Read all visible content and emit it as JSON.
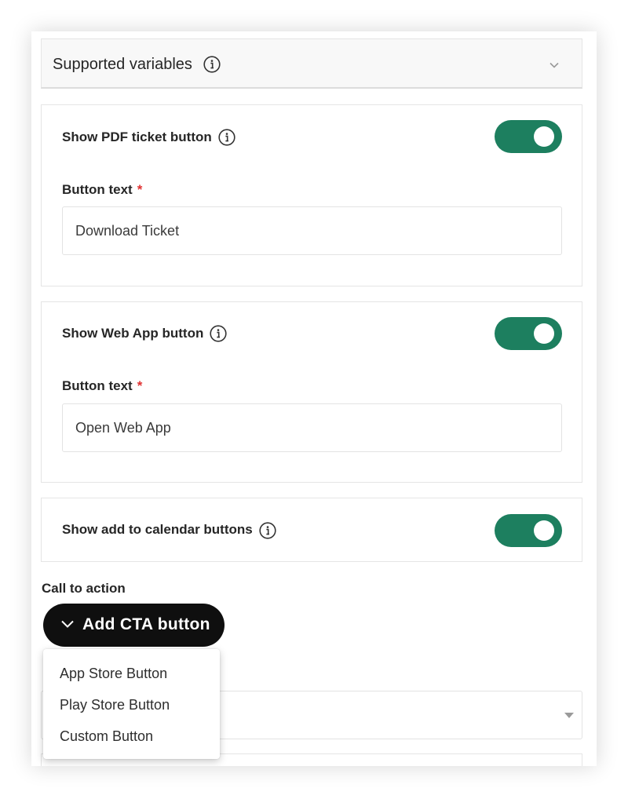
{
  "supported_variables": {
    "title": "Supported variables"
  },
  "sections": [
    {
      "toggle_label": "Show PDF ticket button",
      "toggle_on": true,
      "field_label": "Button text",
      "required_mark": "*",
      "field_value": "Download Ticket"
    },
    {
      "toggle_label": "Show Web App button",
      "toggle_on": true,
      "field_label": "Button text",
      "required_mark": "*",
      "field_value": "Open Web App"
    },
    {
      "toggle_label": "Show add to calendar buttons",
      "toggle_on": true
    }
  ],
  "call_to_action": {
    "label": "Call to action",
    "add_button_label": "Add CTA button",
    "menu_items": [
      "App Store Button",
      "Play Store Button",
      "Custom Button"
    ]
  },
  "colors": {
    "toggle_on": "#1d7f5f",
    "cta_button": "#0f0f0f",
    "required": "#e03131"
  },
  "icons": {
    "info": "info-icon",
    "collapse": "chevron-down-icon",
    "dropdown": "caret-down-icon"
  }
}
